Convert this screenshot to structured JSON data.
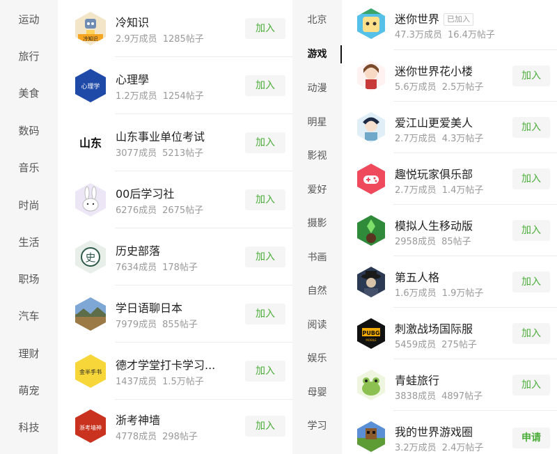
{
  "left_categories": [
    "运动",
    "旅行",
    "美食",
    "数码",
    "音乐",
    "时尚",
    "生活",
    "职场",
    "汽车",
    "理财",
    "萌宠",
    "科技"
  ],
  "right_categories": [
    "北京",
    "游戏",
    "动漫",
    "明星",
    "影视",
    "爱好",
    "摄影",
    "书画",
    "自然",
    "阅读",
    "娱乐",
    "母婴",
    "学习"
  ],
  "right_active_category": "游戏",
  "left_groups": [
    {
      "name": "冷知识",
      "members": "2.9万成员",
      "posts": "1285帖子",
      "action": "加入",
      "icon": "robot-avatar-icon",
      "logo_text": "冷知识"
    },
    {
      "name": "心理學",
      "members": "1.2万成员",
      "posts": "1254帖子",
      "action": "加入",
      "icon": "psychology-logo-icon",
      "logo_text": "心理学"
    },
    {
      "name": "山东事业单位考试",
      "members": "3077成员",
      "posts": "5213帖子",
      "action": "加入",
      "icon": "shandong-text-icon",
      "logo_text": "山东"
    },
    {
      "name": "00后学习社",
      "members": "6276成员",
      "posts": "2675帖子",
      "action": "加入",
      "icon": "rabbit-avatar-icon"
    },
    {
      "name": "历史部落",
      "members": "7634成员",
      "posts": "178帖子",
      "action": "加入",
      "icon": "history-seal-icon",
      "logo_text": "史"
    },
    {
      "name": "学日语聊日本",
      "members": "7979成员",
      "posts": "855帖子",
      "action": "加入",
      "icon": "landscape-photo-icon"
    },
    {
      "name": "德才学堂打卡学习...",
      "members": "1437成员",
      "posts": "1.5万帖子",
      "action": "加入",
      "icon": "calligraphy-yellow-icon",
      "logo_text": "金半手书"
    },
    {
      "name": "浙考神墙",
      "members": "4778成员",
      "posts": "298帖子",
      "action": "加入",
      "icon": "zhekao-red-icon",
      "logo_text": "浙考墙神"
    }
  ],
  "right_groups": [
    {
      "name": "迷你世界",
      "members": "47.3万成员",
      "posts": "16.4万帖子",
      "badge": "已加入",
      "icon": "mini-world-icon"
    },
    {
      "name": "迷你世界花小楼",
      "members": "5.6万成员",
      "posts": "2.5万帖子",
      "action": "加入",
      "icon": "anime-girl-icon"
    },
    {
      "name": "爱江山更爱美人",
      "members": "2.7万成员",
      "posts": "4.3万帖子",
      "action": "加入",
      "icon": "costume-girl-icon"
    },
    {
      "name": "趣悦玩家俱乐部",
      "members": "2.7万成员",
      "posts": "1.4万帖子",
      "action": "加入",
      "icon": "gamepad-icon"
    },
    {
      "name": "模拟人生移动版",
      "members": "2958成员",
      "posts": "85帖子",
      "action": "加入",
      "icon": "sims-plumbob-icon"
    },
    {
      "name": "第五人格",
      "members": "1.6万成员",
      "posts": "1.9万帖子",
      "action": "加入",
      "icon": "identity-v-icon"
    },
    {
      "name": "刺激战场国际服",
      "members": "5459成员",
      "posts": "275帖子",
      "action": "加入",
      "icon": "pubg-logo-icon",
      "logo_text": "PUBG",
      "logo_subtext": "MOBILE"
    },
    {
      "name": "青蛙旅行",
      "members": "3838成员",
      "posts": "4897帖子",
      "action": "加入",
      "icon": "travel-frog-icon"
    },
    {
      "name": "我的世界游戏圈",
      "members": "3.2万成员",
      "posts": "2.4万帖子",
      "action": "申请",
      "icon": "minecraft-icon"
    }
  ]
}
